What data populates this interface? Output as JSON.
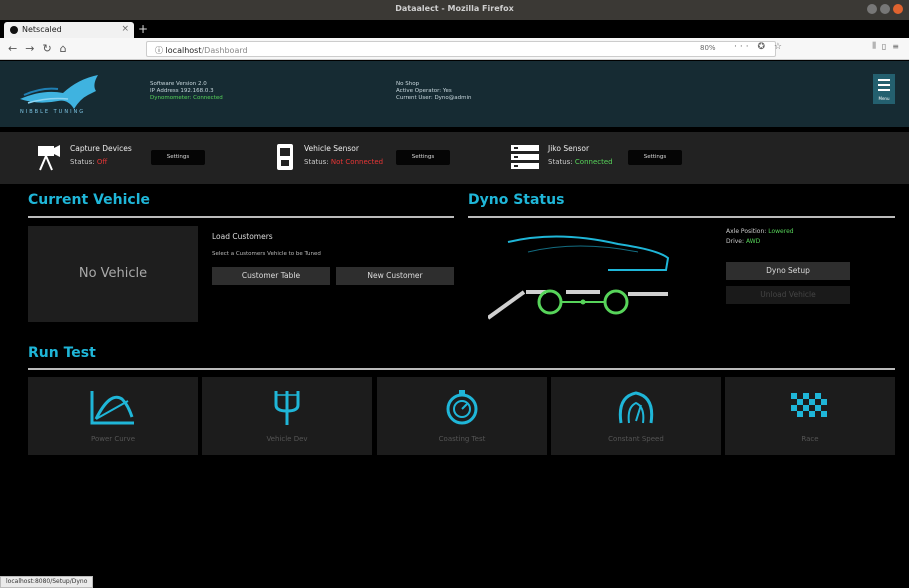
{
  "browser": {
    "window_title": "Dataalect - Mozilla Firefox",
    "tab_title": "Netscaled",
    "url_host": "localhost",
    "url_path": "/Dashboard",
    "zoom_label": "80%"
  },
  "header": {
    "logo_text": "NIBBLE TUNING",
    "info_left": [
      "Software Version 2.0",
      "IP Address 192.168.0.3",
      "Dynomometer: Connected"
    ],
    "info_right": [
      "No Shop",
      "Active Operator: Yes",
      "Current User: Dyno@admin"
    ],
    "menu_label": "Menu"
  },
  "sensors": [
    {
      "name": "Capture Devices",
      "status_label": "Status:",
      "status": "Off",
      "status_state": "bad",
      "button": "Settings"
    },
    {
      "name": "Vehicle Sensor",
      "status_label": "Status:",
      "status": "Not Connected",
      "status_state": "bad",
      "button": "Settings"
    },
    {
      "name": "Jiko Sensor",
      "status_label": "Status:",
      "status": "Connected",
      "status_state": "good",
      "button": "Settings"
    }
  ],
  "current_vehicle": {
    "title": "Current Vehicle",
    "placeholder": "No Vehicle",
    "load_title": "Load Customers",
    "load_subtitle": "Select a Customers Vehicle to be Tuned",
    "customer_table_btn": "Customer Table",
    "new_customer_btn": "New Customer"
  },
  "dyno_status": {
    "title": "Dyno Status",
    "axle_label": "Axle Position:",
    "axle_value": "Lowered",
    "drive_label": "Drive:",
    "drive_value": "AWD",
    "setup_btn": "Dyno Setup",
    "unload_btn": "Unload Vehicle"
  },
  "run_test": {
    "title": "Run Test",
    "tiles": [
      {
        "label": "Power Curve",
        "icon": "power-curve-icon"
      },
      {
        "label": "Vehicle Dev",
        "icon": "fork-icon"
      },
      {
        "label": "Coasting Test",
        "icon": "stopwatch-icon"
      },
      {
        "label": "Constant Speed",
        "icon": "gauge-icon"
      },
      {
        "label": "Race",
        "icon": "checkered-flag-icon"
      }
    ]
  },
  "status_bar_url": "localhost:8080/Setup/Dyno",
  "colors": {
    "accent": "#1fb6d8",
    "header_bg": "#162b33",
    "good": "#57d45a",
    "bad": "#e63535"
  }
}
